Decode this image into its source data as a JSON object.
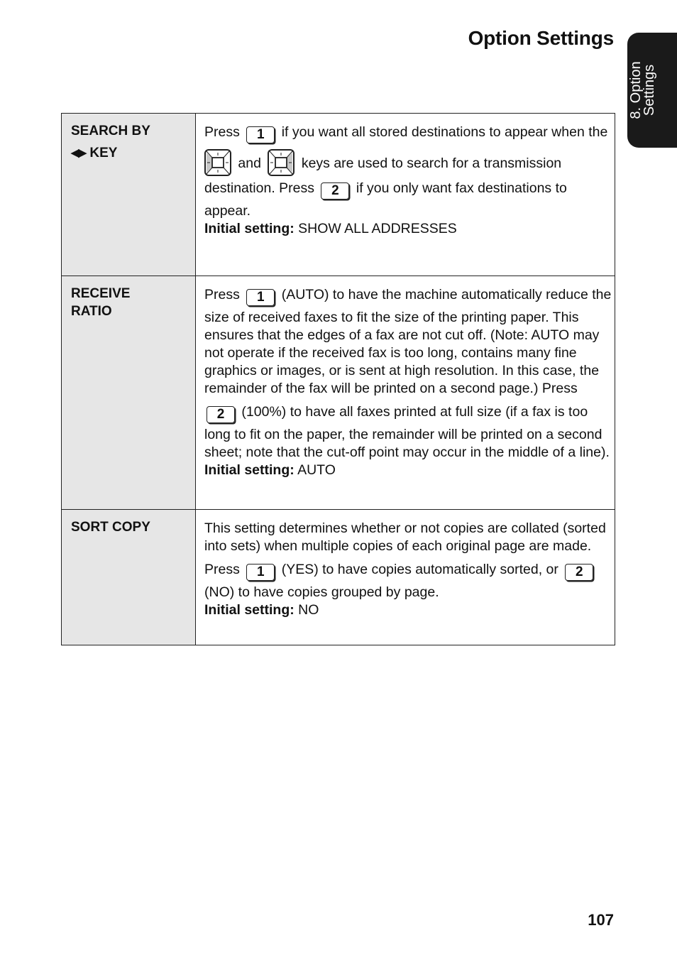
{
  "header": {
    "title": "Option Settings"
  },
  "side_tab": {
    "line1": "8. Option",
    "line2": "Settings"
  },
  "rows": [
    {
      "label_line1": "SEARCH BY",
      "label_arrows": "◀▶",
      "label_line2": "KEY",
      "text_press": "Press",
      "key1": "1",
      "text_a": "if you want all stored destinations to appear when the",
      "text_and": "and",
      "text_b": "keys are used to search for a transmission",
      "text_c": "destination. Press",
      "key2": "2",
      "text_d": "if you only want fax destinations to",
      "text_e": "appear.",
      "initial_label": "Initial setting:",
      "initial_value": "SHOW ALL ADDRESSES"
    },
    {
      "label_line1": "RECEIVE",
      "label_line2": "RATIO",
      "text_press": "Press",
      "key1": "1",
      "text_a": "(AUTO) to have the machine automatically reduce the",
      "text_b": "size of received faxes to fit the size of the printing paper. This ensures that the edges of a fax are not cut off. (Note: AUTO may not operate if the received fax is too long, contains many fine graphics or images, or is sent at high resolution. In this case, the remainder of the fax will be printed on a second page.) Press",
      "key2": "2",
      "text_c": "(100%) to have all faxes printed at full size (if a fax is too",
      "text_d": "long to fit on the paper, the remainder will be printed on a second sheet; note that the cut-off point may occur in the middle of a line).",
      "initial_label": "Initial setting:",
      "initial_value": "AUTO"
    },
    {
      "label_line1": "SORT COPY",
      "text_intro": "This setting determines whether or not copies are collated (sorted into sets) when multiple copies of each original page are made.",
      "text_press": "Press",
      "key1": "1",
      "text_a": "(YES) to have copies automatically sorted, or",
      "key2": "2",
      "text_b": "(NO) to have copies grouped by page.",
      "initial_label": "Initial setting:",
      "initial_value": "NO"
    }
  ],
  "footer": {
    "page_number": "107"
  }
}
